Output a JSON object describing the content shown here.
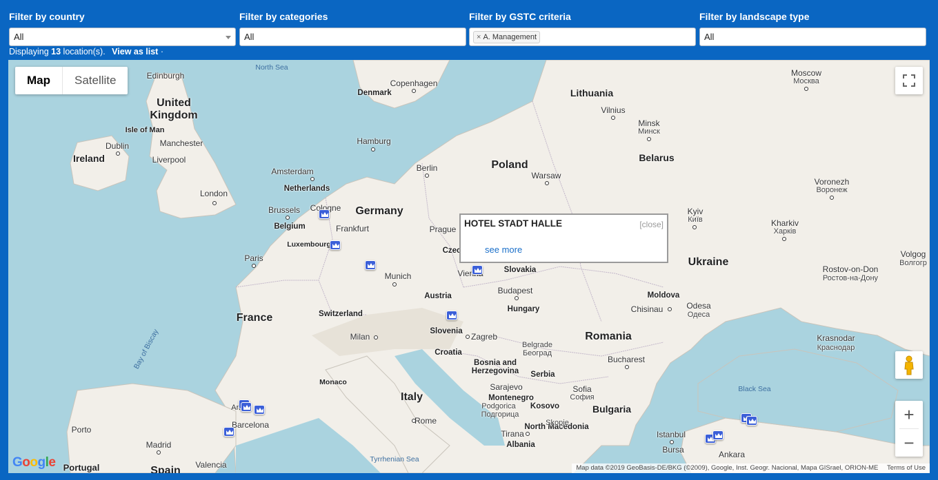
{
  "filters": {
    "country": {
      "label": "Filter by country",
      "value": "All"
    },
    "categories": {
      "label": "Filter by categories",
      "value": "All"
    },
    "gstc": {
      "label": "Filter by GSTC criteria",
      "chip_remove": "×",
      "chip": "A. Management"
    },
    "landscape": {
      "label": "Filter by landscape type",
      "value": "All"
    }
  },
  "status": {
    "prefix": "Displaying",
    "count": "13",
    "suffix": "location(s).",
    "view_list": "View as list",
    "sep": "·"
  },
  "map": {
    "type_buttons": [
      "Map",
      "Satellite"
    ],
    "active_type": "Map",
    "zoom_in": "+",
    "zoom_out": "−",
    "google": "Google",
    "attribution": "Map data ©2019 GeoBasis-DE/BKG (©2009), Google, Inst. Geogr. Nacional, Mapa GISrael, ORION-ME",
    "terms": "Terms of Use",
    "labels": {
      "country": [
        "United Kingdom",
        "Ireland",
        "Poland",
        "Germany",
        "France",
        "Belarus",
        "Lithuania",
        "Ukraine",
        "Romania",
        "Italy",
        "Spain",
        "Portugal",
        "Denmark",
        "Netherlands",
        "Belgium",
        "Luxembourg",
        "Switzerland",
        "Austria",
        "Slovakia",
        "Hungary",
        "Slovenia",
        "Croatia",
        "Bosnia and Herzegovina",
        "Serbia",
        "Montenegro",
        "Kosovo",
        "North Macedonia",
        "Bulgaria",
        "Albania",
        "Moldova",
        "Isle of Man",
        "Monaco",
        "Czechia"
      ],
      "seas": [
        "North Sea",
        "Bay of Biscay",
        "Tyrrhenian Sea",
        "Black Sea"
      ],
      "cities": [
        "Edinburgh",
        "Dublin",
        "Manchester",
        "Liverpool",
        "London",
        "Amsterdam",
        "Brussels",
        "Cologne",
        "Frankfurt",
        "Paris",
        "Hamburg",
        "Berlin",
        "Copenhagen",
        "Prague",
        "Munich",
        "Vienna",
        "Budapest",
        "Zagreb",
        "Milan",
        "Warsaw",
        "Vilnius",
        "Minsk",
        "Kyiv",
        "Kharkiv",
        "Moscow",
        "Voronezh",
        "Chisinau",
        "Odesa",
        "Bucharest",
        "Belgrade",
        "Sarajevo",
        "Sofia",
        "Tirana",
        "Istanbul",
        "Ankara",
        "Bursa",
        "Rome",
        "Barcelona",
        "Madrid",
        "Valencia",
        "Porto",
        "Andorra",
        "Krasnodar",
        "Rostov-on-Don",
        "Volgograd",
        "Podgorica",
        "Skopje"
      ],
      "cities_local": [
        "Минск",
        "Київ",
        "Харків",
        "Москва",
        "Воронеж",
        "Одеса",
        "Ростов-на-Дону",
        "Волгоград",
        "Краснодар",
        "Београд",
        "София",
        "Подгорица",
        "Скопје"
      ]
    }
  },
  "infowindow": {
    "title": "HOTEL STADT HALLE",
    "close": "[close]",
    "link": "see more"
  },
  "colors": {
    "header_bg": "#0a66c2",
    "water": "#aad3df",
    "land": "#f2efe9",
    "marker": "#3b5fd8",
    "link": "#1a6fc9"
  }
}
